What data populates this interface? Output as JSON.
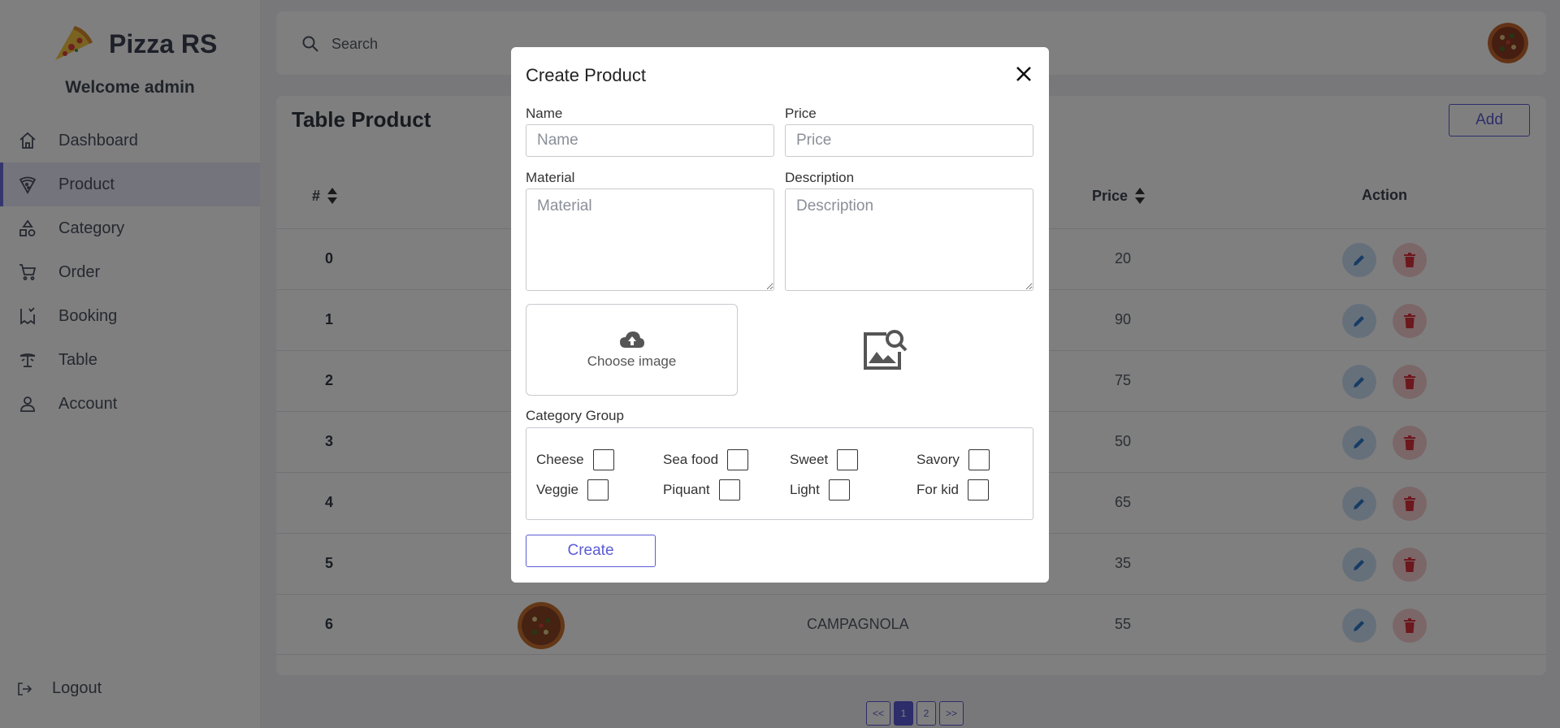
{
  "sidebar": {
    "brand": "Pizza RS",
    "welcome": "Welcome admin",
    "items": [
      {
        "label": "Dashboard",
        "icon": "home-icon"
      },
      {
        "label": "Product",
        "icon": "pizza-slice-icon",
        "active": true
      },
      {
        "label": "Category",
        "icon": "shapes-icon"
      },
      {
        "label": "Order",
        "icon": "cart-icon"
      },
      {
        "label": "Booking",
        "icon": "booking-icon"
      },
      {
        "label": "Table",
        "icon": "table-icon"
      },
      {
        "label": "Account",
        "icon": "user-icon"
      }
    ],
    "logout": "Logout"
  },
  "topbar": {
    "search_placeholder": "Search"
  },
  "panel": {
    "title": "Table Product",
    "add_label": "Add",
    "headers": {
      "num": "#",
      "price": "Price",
      "action": "Action"
    },
    "rows": [
      {
        "num": "0",
        "name": "",
        "price": "20"
      },
      {
        "num": "1",
        "name": "",
        "price": "90"
      },
      {
        "num": "2",
        "name": "",
        "price": "75"
      },
      {
        "num": "3",
        "name": "",
        "price": "50"
      },
      {
        "num": "4",
        "name": "",
        "price": "65"
      },
      {
        "num": "5",
        "name": "",
        "price": "35"
      },
      {
        "num": "6",
        "name": "CAMPAGNOLA",
        "price": "55"
      }
    ]
  },
  "pager": {
    "first": "<<",
    "pages": [
      "1",
      "2"
    ],
    "last": ">>",
    "current": "1"
  },
  "modal": {
    "title": "Create Product",
    "name_label": "Name",
    "name_placeholder": "Name",
    "price_label": "Price",
    "price_placeholder": "Price",
    "material_label": "Material",
    "material_placeholder": "Material",
    "description_label": "Description",
    "description_placeholder": "Description",
    "upload_label": "Choose image",
    "category_group_label": "Category Group",
    "categories": [
      "Cheese",
      "Sea food",
      "Sweet",
      "Savory",
      "Veggie",
      "Piquant",
      "Light",
      "For kid"
    ],
    "create_label": "Create"
  },
  "colors": {
    "accent": "#5b5bd6",
    "edit": "#2f78c8",
    "delete": "#d9303a"
  }
}
